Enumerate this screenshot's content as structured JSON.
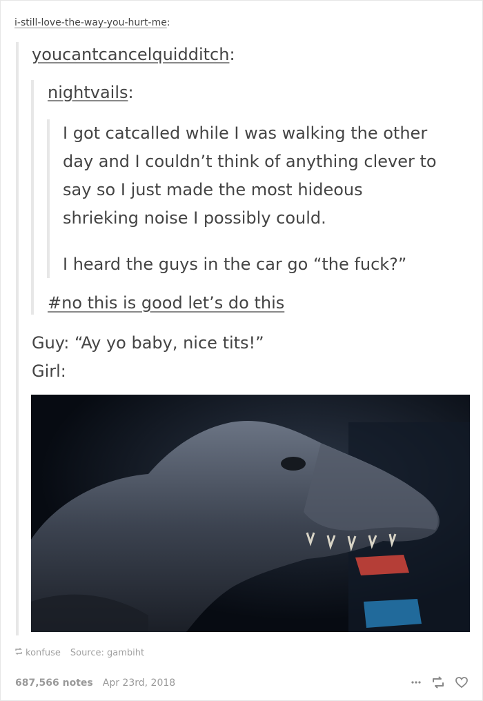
{
  "post": {
    "root_user": "i-still-love-the-way-you-hurt-me",
    "reblog1_user": "youcantcancelquidditch",
    "reblog2_user": "nightvails",
    "original_paragraph1_lines": [
      "I got catcalled while I was walking the other",
      "day and I couldn’t think of anything clever to",
      "say so I just made the most hideous",
      "shrieking noise I possibly could."
    ],
    "original_paragraph2": "I heard the guys in the car go “the fuck?”",
    "tag": "#no this is good let’s do this",
    "dialog_line1": "Guy: “Ay yo baby, nice tits!”",
    "dialog_line2": "Girl:",
    "colon": ":"
  },
  "meta": {
    "reblogged_from": "konfuse",
    "source_label": "Source:",
    "source_name": "gambiht"
  },
  "footer": {
    "notes": "687,566 notes",
    "date": "Apr 23rd, 2018"
  },
  "icons": {
    "more": "more-icon",
    "reblog": "reblog-icon",
    "like": "heart-icon"
  },
  "colors": {
    "text": "#444444",
    "muted": "#a0a0a0",
    "border": "#e7e7e7"
  }
}
